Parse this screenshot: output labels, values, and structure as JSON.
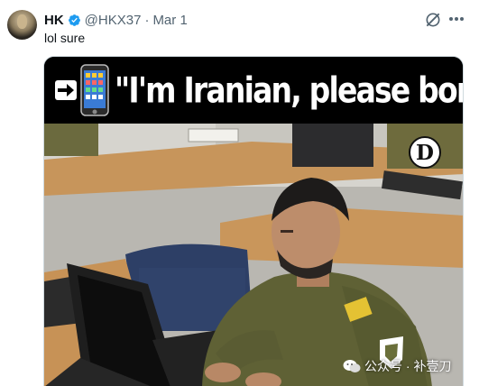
{
  "tweet": {
    "author_name": "HK",
    "handle": "@HKX37",
    "separator": "·",
    "date": "Mar 1",
    "text": "lol sure"
  },
  "media": {
    "caption": "\"I'm Iranian, please bomb us.\"",
    "publisher_mark": "D"
  },
  "watermark": {
    "text": "公众号 · 补壹刀"
  },
  "colors": {
    "verified": "#1d9bf0",
    "secondary_text": "#536471",
    "uniform": "#5f6135"
  },
  "icons": {
    "verified": "verified-badge-icon",
    "grok": "grok-icon",
    "more": "more-icon",
    "arrow": "arrow-right-icon",
    "phone": "phone-icon",
    "wechat": "wechat-icon"
  }
}
